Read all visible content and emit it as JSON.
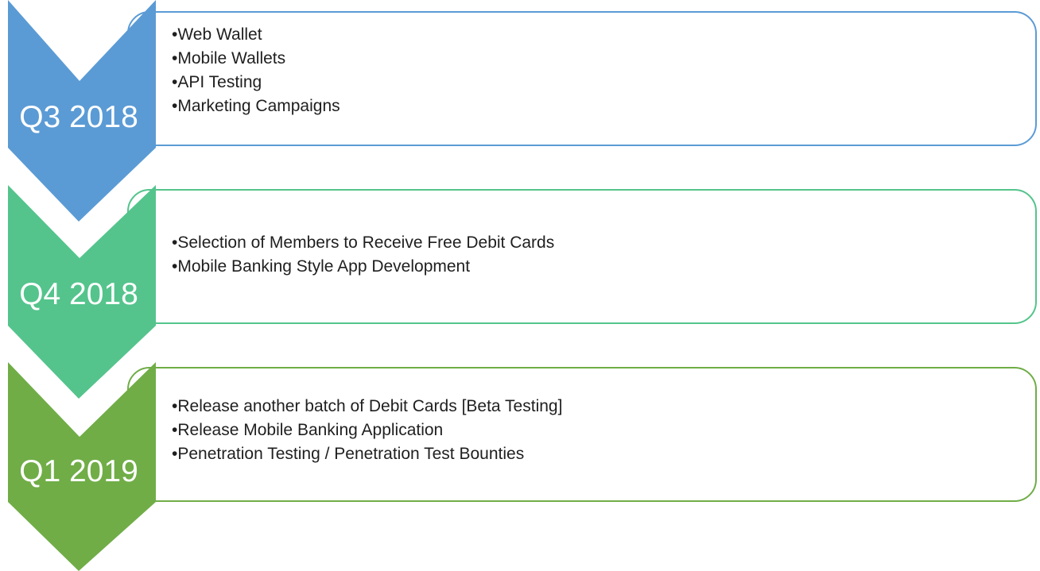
{
  "colors": {
    "q3": "#5b9bd5",
    "q4": "#54c48c",
    "q1": "#70ad47"
  },
  "phases": [
    {
      "label": "Q3 2018",
      "items": [
        "Web Wallet",
        "Mobile Wallets",
        "API Testing",
        "Marketing Campaigns"
      ]
    },
    {
      "label": "Q4 2018",
      "items": [
        "Selection of Members to Receive Free Debit Cards",
        "Mobile Banking Style App Development"
      ]
    },
    {
      "label": "Q1 2019",
      "items": [
        "Release another batch of Debit Cards [Beta Testing]",
        "Release Mobile Banking Application",
        "Penetration Testing / Penetration Test Bounties"
      ]
    }
  ]
}
